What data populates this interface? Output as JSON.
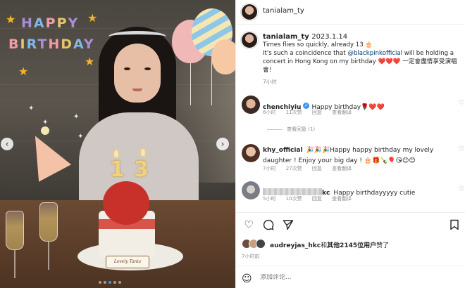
{
  "photo": {
    "decor_line1": [
      "H",
      "A",
      "P",
      "P",
      "Y"
    ],
    "decor_line2": [
      "B",
      "I",
      "R",
      "T",
      "H",
      "D",
      "A",
      "Y"
    ],
    "candle_digits": [
      "1",
      "3"
    ],
    "cake_plaque": "Lovely Tania"
  },
  "post": {
    "author": "tanialam_ty",
    "caption_username": "tanialam_ty",
    "caption_date": "2023.1.14",
    "caption_line1": "Times flies so quickly, already 13 🎂",
    "caption_line2_pre": "It's such a coincidence that ",
    "caption_mention": "@blackpinkofficial",
    "caption_line2_post": " will be holding a concert in Hong Kong on my birthday ",
    "caption_hearts": "❤️❤️❤️",
    "caption_chinese": "一定會盡情享受演唱會！",
    "caption_time": "7小时"
  },
  "comments": [
    {
      "username": "chenchiyiu",
      "verified": true,
      "text": "Happy birthday🌹❤️❤️",
      "time": "6小时",
      "likes": "11次赞",
      "reply": "回复",
      "translate": "查看翻译",
      "view_replies": "查看回复 (1)"
    },
    {
      "username": "khy_official",
      "verified": false,
      "text": "🎉🎉🎉Happy happy birthday my lovely daughter ! Enjoy your big day ! 🎂🎁🍾🎈😘😊😊",
      "time": "7小时",
      "likes": "27次赞",
      "reply": "回复",
      "translate": "查看翻译"
    },
    {
      "username_suffix": "kc",
      "verified": false,
      "text": "Happy birthdayyyyy cutie",
      "time": "5小时",
      "likes": "10次赞",
      "reply": "回复",
      "translate": "查看翻译"
    }
  ],
  "likes_summary": {
    "user": "audreyjas_hkc",
    "connector": "和",
    "others": "其他2145位用户",
    "suffix": "赞了"
  },
  "post_time": "7小时前",
  "comment_input": {
    "placeholder": "添加评论..."
  },
  "colors": {
    "link": "#00376b",
    "verified": "#3897f0",
    "heart": "#e0245e",
    "muted": "#8e8e8e"
  },
  "icons": [
    "heart-icon",
    "comment-icon",
    "share-icon",
    "bookmark-icon",
    "emoji-icon",
    "more-icon"
  ]
}
